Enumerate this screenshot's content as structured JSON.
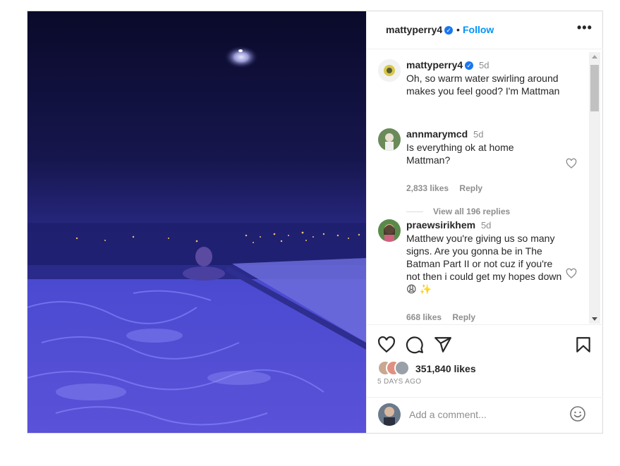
{
  "header": {
    "username": "mattyperry4",
    "separator": "•",
    "follow_label": "Follow",
    "more_label": "•••"
  },
  "caption": {
    "username": "mattyperry4",
    "time": "5d",
    "text": "Oh, so warm water swirling around makes you feel good? I'm Mattman"
  },
  "comments": [
    {
      "username": "annmarymcd",
      "time": "5d",
      "text": "Is everything ok at home Mattman?",
      "likes": "2,833 likes",
      "reply": "Reply",
      "view_replies": "View all 196 replies"
    },
    {
      "username": "praewsirikhem",
      "time": "5d",
      "text": "Matthew you're giving us so many signs. Are you gonna be in The Batman Part II or not cuz if you're not then i could get my hopes down😩 ✨",
      "likes": "668 likes",
      "reply": "Reply"
    }
  ],
  "footer": {
    "likes": "351,840 likes",
    "posted": "5 DAYS AGO",
    "comment_placeholder": "Add a comment..."
  },
  "icons": {
    "like": "heart-icon",
    "comment": "comment-icon",
    "share": "paper-plane-icon",
    "save": "bookmark-icon",
    "emoji": "smiley-icon",
    "verified": "verified-badge-icon"
  },
  "colors": {
    "accent": "#0095f6",
    "verified": "#1877f2",
    "muted": "#8e8e8e",
    "text": "#262626"
  }
}
